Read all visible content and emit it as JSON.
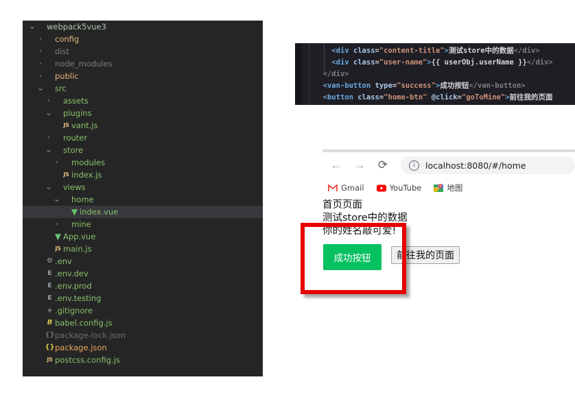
{
  "explorer": {
    "name": "file-explorer",
    "items": [
      {
        "label": "webpack5vue3",
        "depth": 0,
        "twisty": "chevron-down",
        "icon": "none",
        "color": "c-root",
        "selected": false,
        "icon_name": "folder-root"
      },
      {
        "label": "config",
        "depth": 1,
        "twisty": "chevron-right",
        "icon": "none",
        "color": "c-folder",
        "selected": false,
        "icon_name": "folder-config"
      },
      {
        "label": "dist",
        "depth": 1,
        "twisty": "chevron-right",
        "icon": "none",
        "color": "c-folder-dim",
        "selected": false,
        "icon_name": "folder-dist"
      },
      {
        "label": "node_modules",
        "depth": 1,
        "twisty": "chevron-right",
        "icon": "none",
        "color": "c-folder-dim",
        "selected": false,
        "icon_name": "folder-node-modules"
      },
      {
        "label": "public",
        "depth": 1,
        "twisty": "chevron-right",
        "icon": "none",
        "color": "c-folder",
        "selected": false,
        "icon_name": "folder-public"
      },
      {
        "label": "src",
        "depth": 1,
        "twisty": "chevron-down",
        "icon": "none",
        "color": "c-green",
        "selected": false,
        "icon_name": "folder-src"
      },
      {
        "label": "assets",
        "depth": 2,
        "twisty": "chevron-right",
        "icon": "none",
        "color": "c-green",
        "selected": false,
        "icon_name": "folder-assets"
      },
      {
        "label": "plugins",
        "depth": 2,
        "twisty": "chevron-down",
        "icon": "none",
        "color": "c-green",
        "selected": false,
        "icon_name": "folder-plugins"
      },
      {
        "label": "vant.js",
        "depth": 3,
        "twisty": "none",
        "icon": "JS",
        "color": "c-green",
        "selected": false,
        "icon_name": "js-file-icon"
      },
      {
        "label": "router",
        "depth": 2,
        "twisty": "chevron-right",
        "icon": "none",
        "color": "c-green",
        "selected": false,
        "icon_name": "folder-router"
      },
      {
        "label": "store",
        "depth": 2,
        "twisty": "chevron-down",
        "icon": "none",
        "color": "c-green",
        "selected": false,
        "icon_name": "folder-store"
      },
      {
        "label": "modules",
        "depth": 3,
        "twisty": "chevron-right",
        "icon": "none",
        "color": "c-green",
        "selected": false,
        "icon_name": "folder-modules"
      },
      {
        "label": "index.js",
        "depth": 3,
        "twisty": "none",
        "icon": "JS",
        "color": "c-green",
        "selected": false,
        "icon_name": "js-file-icon"
      },
      {
        "label": "views",
        "depth": 2,
        "twisty": "chevron-down",
        "icon": "none",
        "color": "c-green",
        "selected": false,
        "icon_name": "folder-views"
      },
      {
        "label": "home",
        "depth": 3,
        "twisty": "chevron-down",
        "icon": "none",
        "color": "c-green",
        "selected": false,
        "icon_name": "folder-home"
      },
      {
        "label": "index.vue",
        "depth": 4,
        "twisty": "none",
        "icon": "V",
        "color": "c-green",
        "selected": true,
        "icon_name": "vue-file-icon"
      },
      {
        "label": "mine",
        "depth": 3,
        "twisty": "chevron-right",
        "icon": "none",
        "color": "c-green",
        "selected": false,
        "icon_name": "folder-mine"
      },
      {
        "label": "App.vue",
        "depth": 2,
        "twisty": "none",
        "icon": "V",
        "color": "c-green",
        "selected": false,
        "icon_name": "vue-file-icon"
      },
      {
        "label": "main.js",
        "depth": 2,
        "twisty": "none",
        "icon": "JS",
        "color": "c-green",
        "selected": false,
        "icon_name": "js-file-icon"
      },
      {
        "label": ".env",
        "depth": 1,
        "twisty": "none",
        "icon": "GEAR",
        "color": "c-green",
        "selected": false,
        "icon_name": "gear-icon"
      },
      {
        "label": ".env.dev",
        "depth": 1,
        "twisty": "none",
        "icon": "E",
        "color": "c-green",
        "selected": false,
        "icon_name": "env-file-icon"
      },
      {
        "label": ".env.prod",
        "depth": 1,
        "twisty": "none",
        "icon": "E",
        "color": "c-green",
        "selected": false,
        "icon_name": "env-file-icon"
      },
      {
        "label": ".env.testing",
        "depth": 1,
        "twisty": "none",
        "icon": "E",
        "color": "c-green",
        "selected": false,
        "icon_name": "env-file-icon"
      },
      {
        "label": ".gitignore",
        "depth": 1,
        "twisty": "none",
        "icon": "DIA",
        "color": "c-green",
        "selected": false,
        "icon_name": "gitignore-icon"
      },
      {
        "label": "babel.config.js",
        "depth": 1,
        "twisty": "none",
        "icon": "B",
        "color": "c-green",
        "selected": false,
        "icon_name": "babel-icon"
      },
      {
        "label": "package-lock.json",
        "depth": 1,
        "twisty": "none",
        "icon": "JSONDIM",
        "color": "c-green-dim",
        "selected": false,
        "icon_name": "json-file-icon"
      },
      {
        "label": "package.json",
        "depth": 1,
        "twisty": "none",
        "icon": "JSON",
        "color": "c-orange",
        "selected": false,
        "icon_name": "json-file-icon"
      },
      {
        "label": "postcss.config.js",
        "depth": 1,
        "twisty": "none",
        "icon": "JS",
        "color": "c-green",
        "selected": false,
        "icon_name": "js-file-icon"
      }
    ]
  },
  "code": {
    "name": "vue-template-snippet",
    "lines": [
      [
        {
          "t": "    ",
          "c": "t-txt"
        },
        {
          "t": "<div ",
          "c": "t-tag"
        },
        {
          "t": "class",
          "c": "t-attr"
        },
        {
          "t": "=",
          "c": "t-txt"
        },
        {
          "t": "\"content-title\"",
          "c": "t-str"
        },
        {
          "t": ">",
          "c": "t-tag"
        },
        {
          "t": "测试store中的数据",
          "c": "t-txt"
        },
        {
          "t": "</div>",
          "c": "t-brk"
        }
      ],
      [
        {
          "t": "    ",
          "c": "t-txt"
        },
        {
          "t": "<div ",
          "c": "t-tag"
        },
        {
          "t": "class",
          "c": "t-attr"
        },
        {
          "t": "=",
          "c": "t-txt"
        },
        {
          "t": "\"user-name\"",
          "c": "t-str"
        },
        {
          "t": ">",
          "c": "t-tag"
        },
        {
          "t": "{{ userObj.userName }}",
          "c": "t-mus"
        },
        {
          "t": "</div>",
          "c": "t-brk"
        }
      ],
      [
        {
          "t": "  ",
          "c": "t-txt"
        },
        {
          "t": "</div>",
          "c": "t-brk"
        }
      ],
      [
        {
          "t": "  ",
          "c": "t-txt"
        },
        {
          "t": "<van-button ",
          "c": "t-tag"
        },
        {
          "t": "type",
          "c": "t-attr"
        },
        {
          "t": "=",
          "c": "t-txt"
        },
        {
          "t": "\"success\"",
          "c": "t-str"
        },
        {
          "t": ">",
          "c": "t-tag"
        },
        {
          "t": "成功按钮",
          "c": "t-txt"
        },
        {
          "t": "</van-button>",
          "c": "t-brk"
        }
      ],
      [
        {
          "t": "  ",
          "c": "t-txt"
        },
        {
          "t": "<button ",
          "c": "t-tag"
        },
        {
          "t": "class",
          "c": "t-attr"
        },
        {
          "t": "=",
          "c": "t-txt"
        },
        {
          "t": "\"home-btn\" ",
          "c": "t-str"
        },
        {
          "t": "@click",
          "c": "t-attr"
        },
        {
          "t": "=",
          "c": "t-txt"
        },
        {
          "t": "\"goToMine\"",
          "c": "t-str"
        },
        {
          "t": ">",
          "c": "t-tag"
        },
        {
          "t": "前往我的页面",
          "c": "t-txt"
        }
      ]
    ]
  },
  "browser": {
    "back_label": "←",
    "forward_label": "→",
    "reload_label": "⟳",
    "url": "localhost:8080/#/home",
    "info_glyph": "i",
    "bookmarks": [
      {
        "label": "Gmail",
        "icon": "gmail"
      },
      {
        "label": "YouTube",
        "icon": "youtube"
      },
      {
        "label": "地图",
        "icon": "maps"
      }
    ]
  },
  "page": {
    "line1": "首页页面",
    "line2": "测试store中的数据",
    "line3": "你的姓名敲可爱!",
    "success_button": "成功按钮",
    "home_button": "前往我的页面"
  },
  "colors": {
    "sidebar_bg": "#252526",
    "selected_row": "#37373d",
    "code_bg": "#1e1e24",
    "success_green": "#07c160",
    "annotation_red": "#e60000",
    "omnibox_bg": "#f1f3f4"
  }
}
